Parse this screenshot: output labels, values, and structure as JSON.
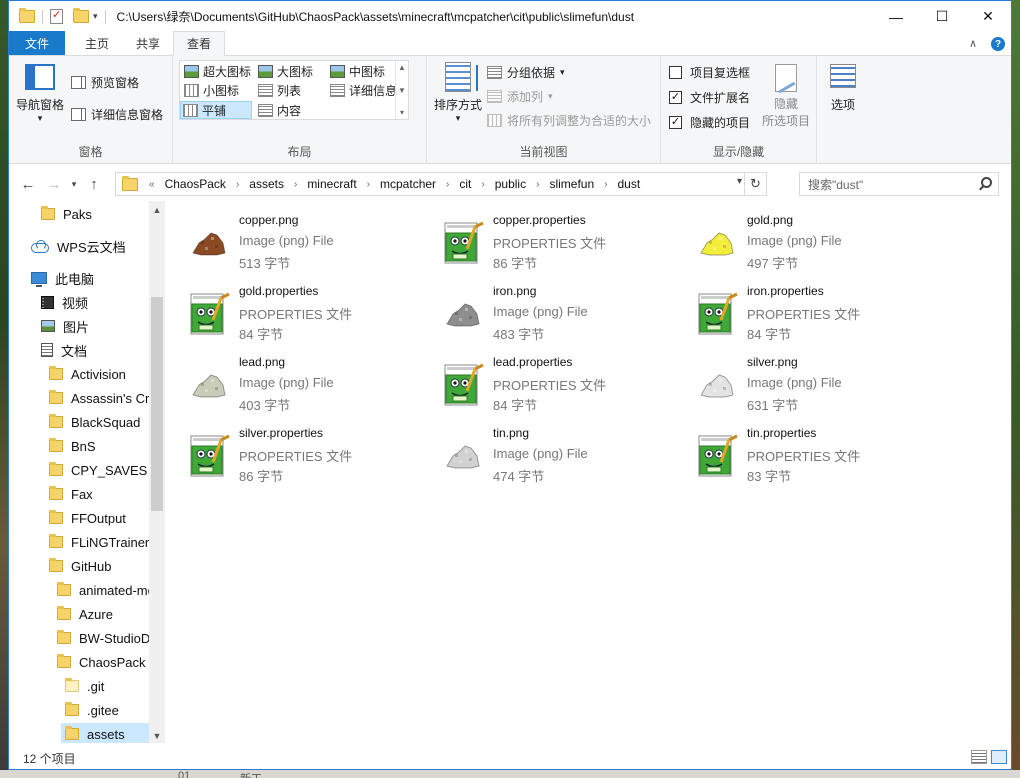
{
  "title_path": "C:\\Users\\绿奈\\Documents\\GitHub\\ChaosPack\\assets\\minecraft\\mcpatcher\\cit\\public\\slimefun\\dust",
  "window_controls": {
    "minimize": "—",
    "maximize": "☐",
    "close": "✕"
  },
  "tabs": [
    {
      "label": "文件"
    },
    {
      "label": "主页"
    },
    {
      "label": "共享"
    },
    {
      "label": "查看"
    }
  ],
  "ribbon": {
    "pane": {
      "nav_pane": "导航窗格",
      "preview_pane": "预览窗格",
      "details_pane": "详细信息窗格",
      "label": "窗格"
    },
    "layout": {
      "items": [
        "超大图标",
        "大图标",
        "中图标",
        "小图标",
        "列表",
        "详细信息",
        "平铺",
        "内容"
      ],
      "selected": "平铺",
      "label": "布局"
    },
    "current_view": {
      "sort_by": "排序方式",
      "group_by": "分组依据",
      "add_columns": "添加列",
      "fit_columns": "将所有列调整为合适的大小",
      "label": "当前视图"
    },
    "show_hide": {
      "item_checkboxes": "项目复选框",
      "file_extensions": "文件扩展名",
      "hidden_items": "隐藏的项目",
      "item_checkboxes_checked": false,
      "file_extensions_checked": true,
      "hidden_items_checked": true,
      "hide_selected_line1": "隐藏",
      "hide_selected_line2": "所选项目",
      "label": "显示/隐藏"
    },
    "options": {
      "label": "选项"
    }
  },
  "address": {
    "overflow": "«",
    "crumbs": [
      "ChaosPack",
      "assets",
      "minecraft",
      "mcpatcher",
      "cit",
      "public",
      "slimefun",
      "dust"
    ],
    "search_placeholder": "搜索\"dust\""
  },
  "nav_pane": {
    "items": [
      {
        "label": "Paks",
        "icon": "folder-icon"
      },
      {
        "label": "WPS云文档",
        "icon": "cloud-icon"
      },
      {
        "label": "此电脑",
        "icon": "computer-icon"
      },
      {
        "label": "视频",
        "icon": "video-icon"
      },
      {
        "label": "图片",
        "icon": "image-icon"
      },
      {
        "label": "文档",
        "icon": "document-icon"
      },
      {
        "label": "Activision",
        "icon": "folder-icon"
      },
      {
        "label": "Assassin's Cre",
        "icon": "folder-icon"
      },
      {
        "label": "BlackSquad",
        "icon": "folder-icon"
      },
      {
        "label": "BnS",
        "icon": "folder-icon"
      },
      {
        "label": "CPY_SAVES",
        "icon": "folder-icon"
      },
      {
        "label": "Fax",
        "icon": "folder-icon"
      },
      {
        "label": "FFOutput",
        "icon": "folder-icon"
      },
      {
        "label": "FLiNGTrainer",
        "icon": "folder-icon"
      },
      {
        "label": "GitHub",
        "icon": "folder-icon"
      },
      {
        "label": "animated-mo",
        "icon": "folder-icon"
      },
      {
        "label": "Azure",
        "icon": "folder-icon"
      },
      {
        "label": "BW-StudioD",
        "icon": "folder-icon"
      },
      {
        "label": "ChaosPack",
        "icon": "folder-icon"
      },
      {
        "label": ".git",
        "icon": "folder-icon"
      },
      {
        "label": ".gitee",
        "icon": "folder-icon"
      },
      {
        "label": "assets",
        "icon": "folder-icon"
      }
    ]
  },
  "files": [
    {
      "name": "copper.png",
      "type": "Image (png) File",
      "size": "513 字节",
      "icon": "copper-dust-icon",
      "color": "#8a4a22"
    },
    {
      "name": "copper.properties",
      "type": "PROPERTIES 文件",
      "size": "86 字节",
      "icon": "properties-file-icon"
    },
    {
      "name": "gold.png",
      "type": "Image (png) File",
      "size": "497 字节",
      "icon": "gold-dust-icon",
      "color": "#f3ee3c"
    },
    {
      "name": "gold.properties",
      "type": "PROPERTIES 文件",
      "size": "84 字节",
      "icon": "properties-file-icon"
    },
    {
      "name": "iron.png",
      "type": "Image (png) File",
      "size": "483 字节",
      "icon": "iron-dust-icon",
      "color": "#8e8e8e"
    },
    {
      "name": "iron.properties",
      "type": "PROPERTIES 文件",
      "size": "84 字节",
      "icon": "properties-file-icon"
    },
    {
      "name": "lead.png",
      "type": "Image (png) File",
      "size": "403 字节",
      "icon": "lead-dust-icon",
      "color": "#c9ccb8"
    },
    {
      "name": "lead.properties",
      "type": "PROPERTIES 文件",
      "size": "84 字节",
      "icon": "properties-file-icon"
    },
    {
      "name": "silver.png",
      "type": "Image (png) File",
      "size": "631 字节",
      "icon": "silver-dust-icon",
      "color": "#e3e3e3"
    },
    {
      "name": "silver.properties",
      "type": "PROPERTIES 文件",
      "size": "86 字节",
      "icon": "properties-file-icon"
    },
    {
      "name": "tin.png",
      "type": "Image (png) File",
      "size": "474 字节",
      "icon": "tin-dust-icon",
      "color": "#d2d2d2"
    },
    {
      "name": "tin.properties",
      "type": "PROPERTIES 文件",
      "size": "83 字节",
      "icon": "properties-file-icon"
    }
  ],
  "status": {
    "count": "12 个项目"
  },
  "background": {
    "taskbar_text_1": "01",
    "taskbar_text_2": "新工"
  }
}
